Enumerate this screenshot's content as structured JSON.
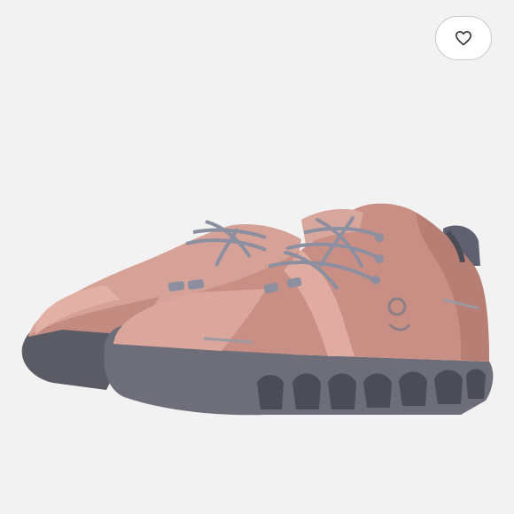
{
  "product": {
    "image_subject": "shoe-pair",
    "colors": {
      "upper": "#c98f84",
      "upper_light": "#e0aba0",
      "upper_shadow": "#a8756d",
      "sole": "#6d6e79",
      "sole_dark": "#4b4c55",
      "laces": "#8c8fa0",
      "background": "#f2f2f2"
    }
  },
  "favorite": {
    "icon": "heart-icon",
    "state": "not-favorited",
    "count": ""
  }
}
